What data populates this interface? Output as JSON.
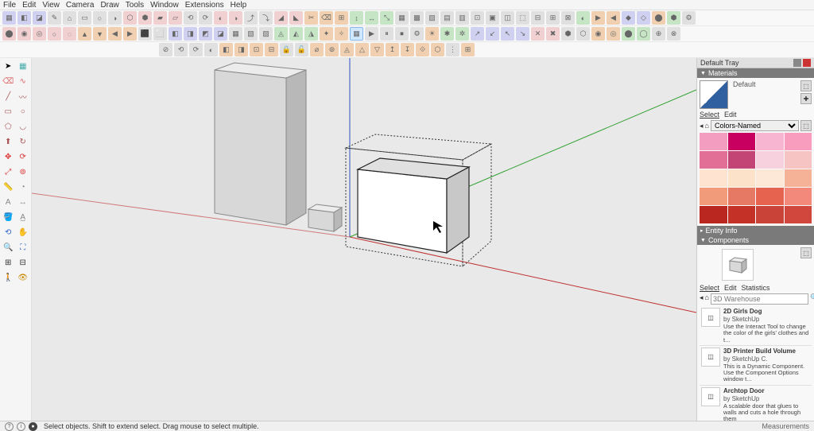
{
  "menu": [
    "File",
    "Edit",
    "View",
    "Camera",
    "Draw",
    "Tools",
    "Window",
    "Extensions",
    "Help"
  ],
  "tray": {
    "title": "Default Tray"
  },
  "materials": {
    "title": "Materials",
    "current_name": "Default",
    "tabs": [
      "Select",
      "Edit"
    ],
    "palette_label": "Colors-Named",
    "colors": [
      "#f39ec0",
      "#c8005f",
      "#f7b5d2",
      "#f99dbe",
      "#e26f96",
      "#c34575",
      "#f8d1de",
      "#f7c4c4",
      "#fde3d0",
      "#fbe2c8",
      "#fde7d6",
      "#f6b297",
      "#f19b7a",
      "#e57963",
      "#e6644f",
      "#f2897a",
      "#b92720",
      "#c33127",
      "#c94339",
      "#d1473e"
    ]
  },
  "entity": {
    "title": "Entity Info"
  },
  "components": {
    "title": "Components",
    "tabs": [
      "Select",
      "Edit",
      "Statistics"
    ],
    "search_placeholder": "3D Warehouse",
    "items": [
      {
        "title": "2D Girls Dog",
        "author": "by SketchUp",
        "desc": "Use the Interact Tool to change the color of the girls' clothes and t..."
      },
      {
        "title": "3D Printer Build Volume",
        "author": "by SketchUp C.",
        "desc": "This is a Dynamic Component. Use the Component Options window t..."
      },
      {
        "title": "Archtop Door",
        "author": "by SketchUp",
        "desc": "A scalable door that glues to walls and cuts a hole through them"
      }
    ]
  },
  "status": {
    "hint": "Select objects. Shift to extend select. Drag mouse to select multiple.",
    "measurements_label": "Measurements"
  }
}
